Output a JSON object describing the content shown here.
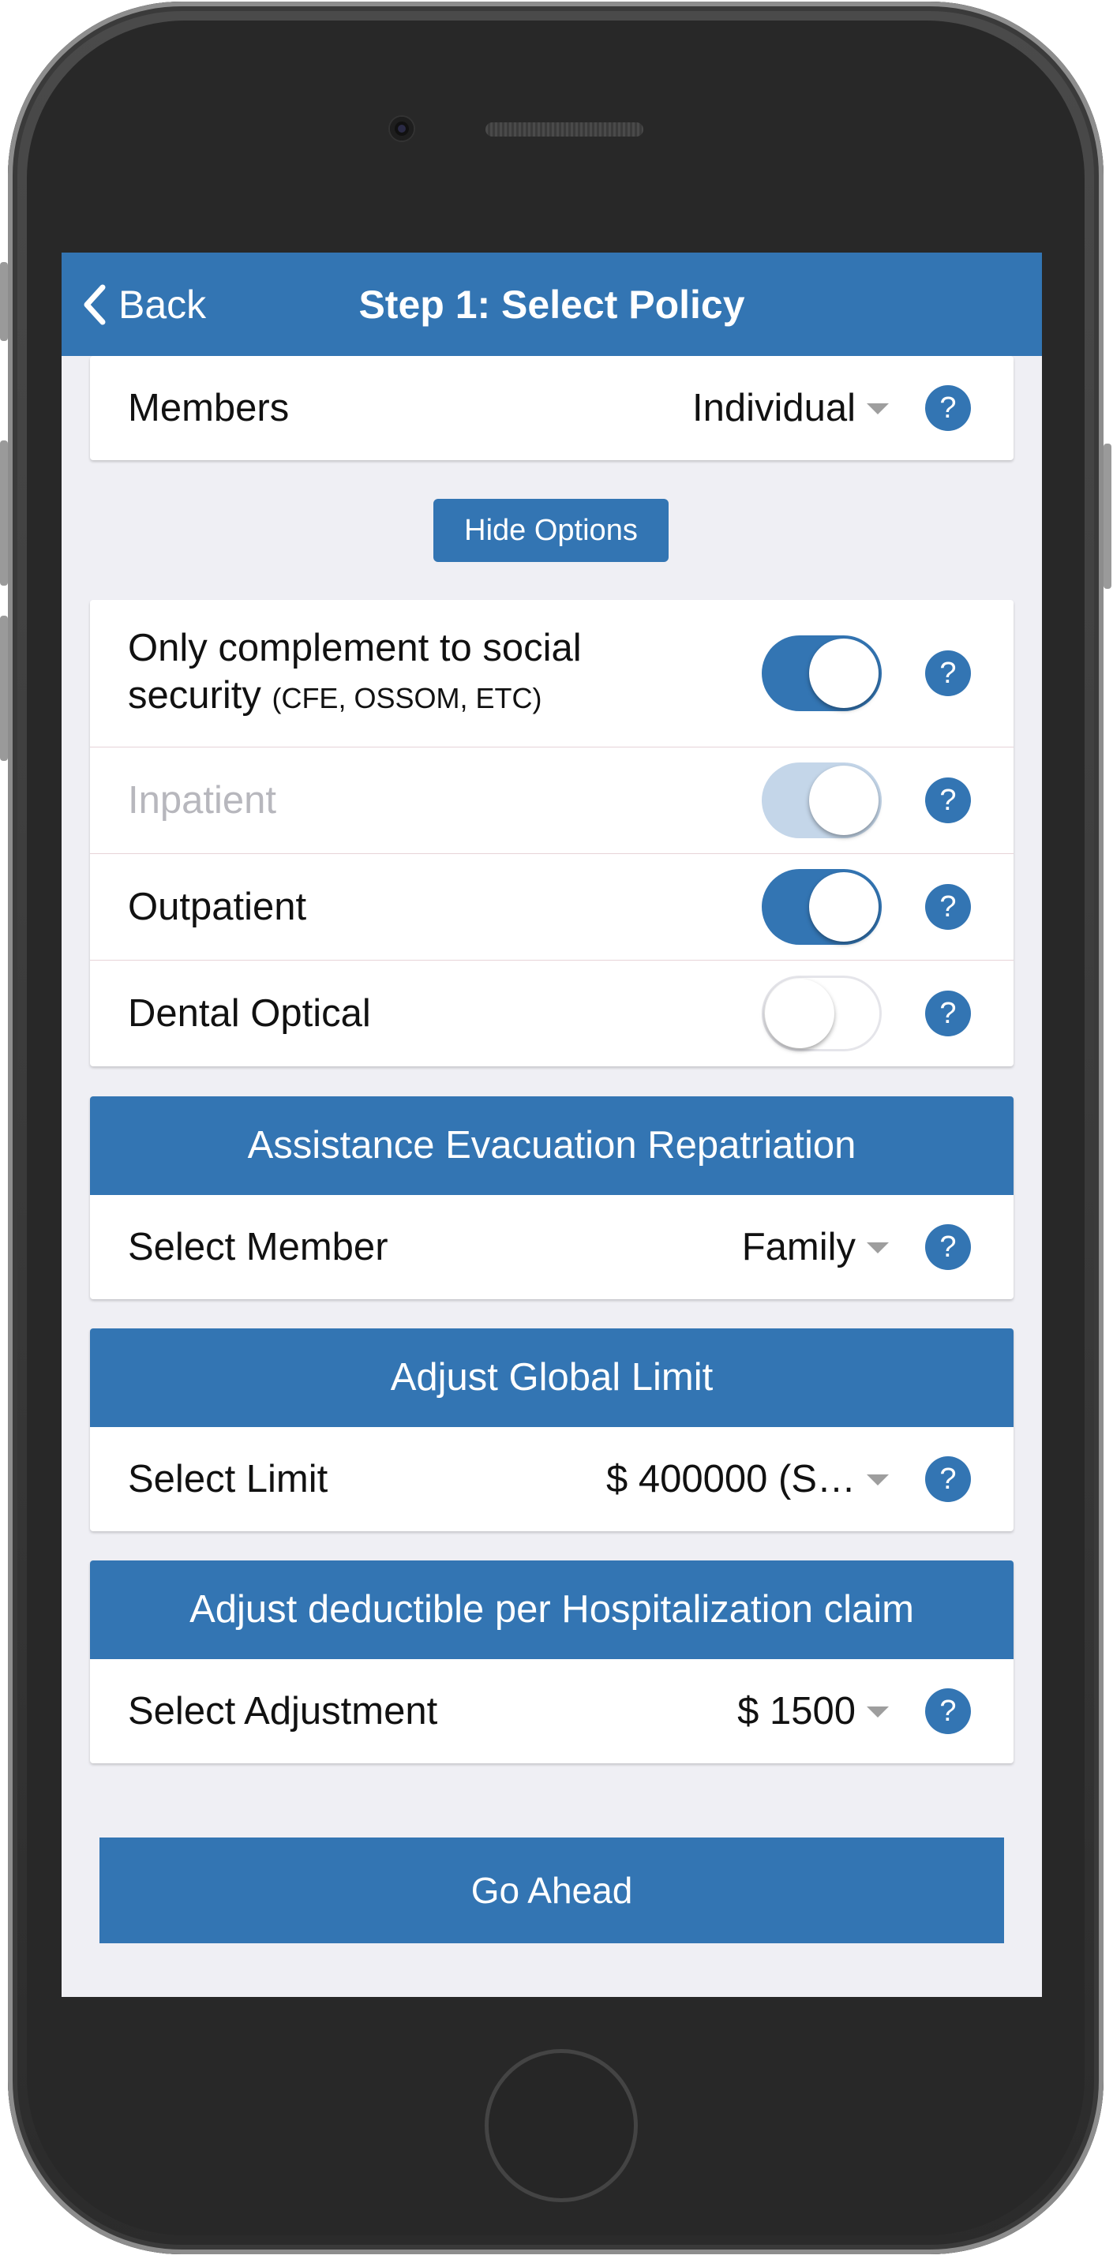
{
  "nav": {
    "back_label": "Back",
    "title": "Step 1: Select Policy"
  },
  "members": {
    "label": "Members",
    "value": "Individual"
  },
  "hide_options_label": "Hide Options",
  "coverage": {
    "social_security": {
      "label": "Only complement to social",
      "label_line2": "security",
      "sub": "(CFE, OSSOM, ETC)",
      "state": "on"
    },
    "inpatient": {
      "label": "Inpatient",
      "state": "on-disabled"
    },
    "outpatient": {
      "label": "Outpatient",
      "state": "on"
    },
    "dental_optical": {
      "label": "Dental Optical",
      "state": "off"
    }
  },
  "assistance": {
    "header": "Assistance Evacuation Repatriation",
    "label": "Select Member",
    "value": "Family"
  },
  "global_limit": {
    "header": "Adjust Global Limit",
    "label": "Select Limit",
    "value": "$ 400000 (S…"
  },
  "deductible": {
    "header": "Adjust deductible per Hospitalization claim",
    "label": "Select Adjustment",
    "value": "$ 1500"
  },
  "help_glyph": "?",
  "go_ahead_label": "Go Ahead",
  "colors": {
    "primary": "#3375b3",
    "background": "#efeff4",
    "disabled_toggle": "#c4d6e9"
  }
}
